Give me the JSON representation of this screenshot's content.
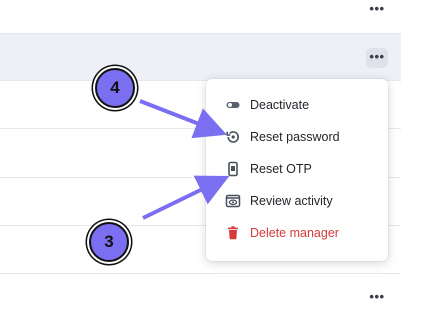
{
  "row_actions": {
    "more_label": "•••"
  },
  "menu": {
    "items": [
      {
        "label": "Deactivate",
        "icon": "toggle-icon"
      },
      {
        "label": "Reset password",
        "icon": "reset-password-icon"
      },
      {
        "label": "Reset OTP",
        "icon": "phone-icon"
      },
      {
        "label": "Review activity",
        "icon": "eye-window-icon"
      },
      {
        "label": "Delete manager",
        "icon": "trash-icon",
        "color": "#d63a3a"
      }
    ]
  },
  "annotations": [
    {
      "label": "4",
      "points_to": "Reset password"
    },
    {
      "label": "3",
      "points_to": "Reset OTP"
    }
  ],
  "colors": {
    "accent": "#7a6ff0",
    "danger": "#d63a3a",
    "row_highlight": "#eef0f6"
  }
}
